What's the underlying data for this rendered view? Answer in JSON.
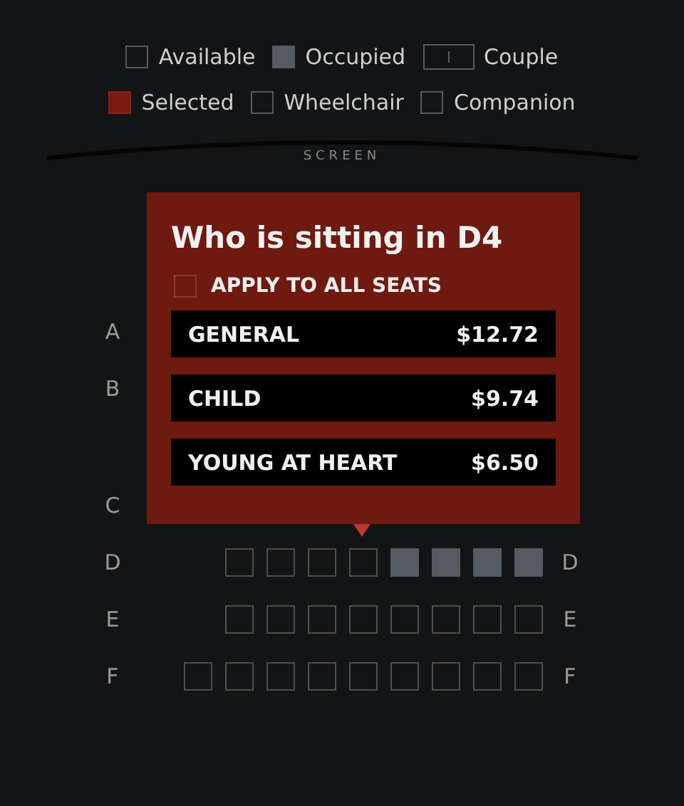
{
  "legend": [
    {
      "kind": "available",
      "label": "Available"
    },
    {
      "kind": "occupied",
      "label": "Occupied"
    },
    {
      "kind": "couple",
      "label": "Couple"
    },
    {
      "kind": "selected",
      "label": "Selected"
    },
    {
      "kind": "wheelchair",
      "label": "Wheelchair"
    },
    {
      "kind": "companion",
      "label": "Companion"
    }
  ],
  "screen_label": "SCREEN",
  "rows": [
    {
      "label": "A"
    },
    {
      "label": "B"
    },
    {
      "label": "C"
    },
    {
      "label": "D",
      "right_label": "D",
      "seats": [
        {
          "occupied": false
        },
        {
          "occupied": false
        },
        {
          "occupied": false
        },
        {
          "occupied": false
        },
        {
          "occupied": true
        },
        {
          "occupied": true
        },
        {
          "occupied": true
        },
        {
          "occupied": true
        }
      ]
    },
    {
      "label": "E",
      "right_label": "E",
      "seats": [
        {
          "occupied": false
        },
        {
          "occupied": false
        },
        {
          "occupied": false
        },
        {
          "occupied": false
        },
        {
          "occupied": false
        },
        {
          "occupied": false
        },
        {
          "occupied": false
        },
        {
          "occupied": false
        }
      ]
    },
    {
      "label": "F",
      "right_label": "F",
      "seats": [
        {
          "occupied": false
        },
        {
          "occupied": false
        },
        {
          "occupied": false
        },
        {
          "occupied": false
        },
        {
          "occupied": false
        },
        {
          "occupied": false
        },
        {
          "occupied": false
        },
        {
          "occupied": false
        },
        {
          "occupied": false
        }
      ]
    }
  ],
  "popup": {
    "title": "Who is sitting in D4",
    "apply_all": {
      "label": "APPLY TO ALL SEATS",
      "checked": false
    },
    "options": [
      {
        "label": "GENERAL",
        "price": "$12.72"
      },
      {
        "label": "CHILD",
        "price": "$9.74"
      },
      {
        "label": "YOUNG AT HEART",
        "price": "$6.50"
      }
    ]
  }
}
